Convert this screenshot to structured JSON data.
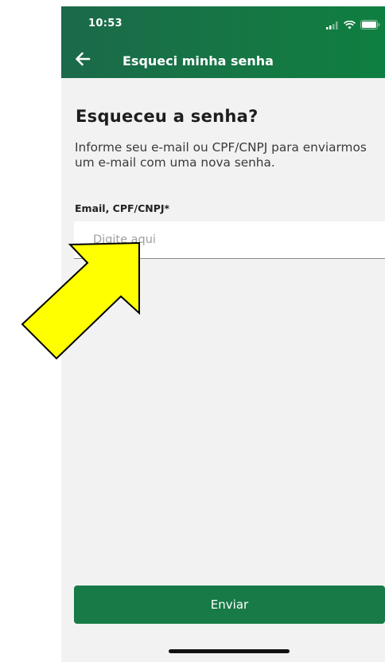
{
  "status_bar": {
    "time": "10:53",
    "icons": [
      "cellular-signal-icon",
      "wifi-icon",
      "battery-icon"
    ]
  },
  "nav_bar": {
    "back_icon": "back-arrow-icon",
    "title": "Esqueci minha senha"
  },
  "page": {
    "heading": "Esqueceu a senha?",
    "description": "Informe seu e-mail ou CPF/CNPJ para enviarmos um e-mail com uma nova senha."
  },
  "form": {
    "identifier_field": {
      "label": "Email, CPF/CNPJ*",
      "value": "",
      "placeholder": "Digite aqui"
    },
    "submit_label": "Enviar"
  },
  "annotation": {
    "icon": "pointer-arrow-icon",
    "color": "#ffff00",
    "outline": "#000000"
  },
  "colors": {
    "brand_green": "#177a47",
    "header_gradient_start": "#1b6a4a",
    "header_gradient_end": "#0f7f3f",
    "background": "#f2f2f2"
  }
}
